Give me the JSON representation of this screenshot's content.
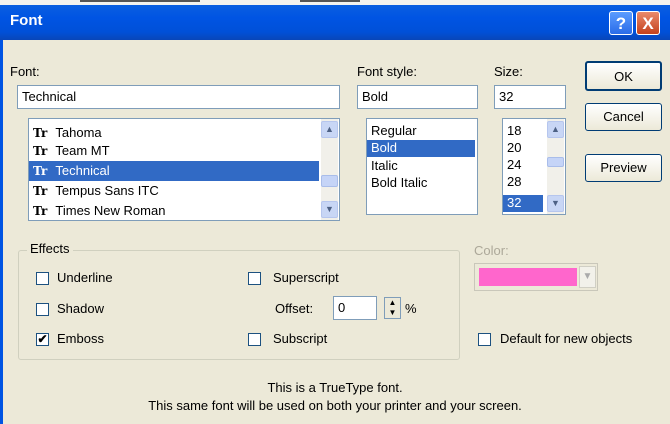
{
  "window": {
    "title": "Font",
    "help_glyph": "?",
    "close_glyph": "X"
  },
  "font_label": "Font:",
  "font_value": "Technical",
  "font_list": [
    {
      "icon": "truetype-icon",
      "glyph": "Tr",
      "name": "Tahoma",
      "selected": false
    },
    {
      "icon": "truetype-icon",
      "glyph": "Tr",
      "name": "Team MT",
      "selected": false
    },
    {
      "icon": "truetype-icon",
      "glyph": "Tr",
      "name": "Technical",
      "selected": true
    },
    {
      "icon": "truetype-icon",
      "glyph": "Tr",
      "name": "Tempus Sans ITC",
      "selected": false
    },
    {
      "icon": "truetype-icon",
      "glyph": "Tr",
      "name": "Times New Roman",
      "selected": false
    }
  ],
  "style_label": "Font style:",
  "style_value": "Bold",
  "style_list": [
    {
      "name": "Regular",
      "selected": false
    },
    {
      "name": "Bold",
      "selected": true
    },
    {
      "name": "Italic",
      "selected": false
    },
    {
      "name": "Bold Italic",
      "selected": false
    }
  ],
  "size_label": "Size:",
  "size_value": "32",
  "size_list": [
    {
      "name": "18",
      "selected": false
    },
    {
      "name": "20",
      "selected": false
    },
    {
      "name": "24",
      "selected": false
    },
    {
      "name": "28",
      "selected": false
    },
    {
      "name": "32",
      "selected": true
    }
  ],
  "buttons": {
    "ok": "OK",
    "cancel": "Cancel",
    "preview": "Preview"
  },
  "effects": {
    "legend": "Effects",
    "underline": {
      "label": "Underline",
      "checked": false
    },
    "shadow": {
      "label": "Shadow",
      "checked": false
    },
    "emboss": {
      "label": "Emboss",
      "checked": true
    },
    "superscript": {
      "label": "Superscript",
      "checked": false
    },
    "subscript": {
      "label": "Subscript",
      "checked": false
    },
    "offset_label": "Offset:",
    "offset_value": "0",
    "offset_unit": "%"
  },
  "color": {
    "label": "Color:",
    "value_color": "#ff66cc"
  },
  "default_new_objects": {
    "label": "Default for new objects",
    "checked": false
  },
  "info": {
    "line1": "This is a TrueType font.",
    "line2": "This same font will be used on both your printer and your screen."
  },
  "checkmark_glyph": "✔",
  "arrows": {
    "up": "▲",
    "down": "▼"
  }
}
